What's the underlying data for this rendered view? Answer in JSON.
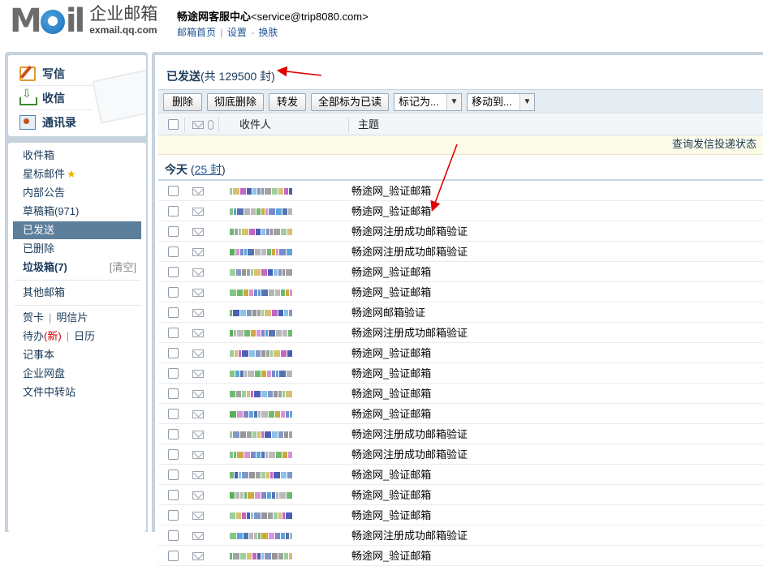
{
  "header": {
    "logo_mark": "M",
    "logo_mark_rest": "il",
    "logo_cn": "企业邮箱",
    "logo_en": "exmail.qq.com",
    "account_name": "畅途网客服中心",
    "account_email": "<service@trip8080.com>",
    "links": [
      "邮箱首页",
      "设置",
      "换肤"
    ],
    "link_sep": "|",
    "link_sep2": "-"
  },
  "quick_actions": [
    {
      "label": "写信",
      "icon": "pencil-icon"
    },
    {
      "label": "收信",
      "icon": "inbox-download-icon"
    },
    {
      "label": "通讯录",
      "icon": "address-book-icon"
    }
  ],
  "folders": {
    "inbox": "收件箱",
    "starred": "星标邮件",
    "notices": "内部公告",
    "drafts": "草稿箱(971)",
    "sent": "已发送",
    "deleted": "已删除",
    "junk": "垃圾箱(7)",
    "junk_clear": "[清空]",
    "other": "其他邮箱",
    "card": "贺卡",
    "postcard": "明信片",
    "todo": "待办",
    "todo_new": "(新)",
    "calendar": "日历",
    "notes": "记事本",
    "disk": "企业网盘",
    "transfer": "文件中转站",
    "pipe": "|"
  },
  "main": {
    "title_bold": "已发送",
    "title_count": "(共 129500 封)",
    "toolbar": {
      "delete": "删除",
      "perm_delete": "彻底删除",
      "forward": "转发",
      "mark_all_read": "全部标为已读",
      "mark_as": "标记为...",
      "move_to": "移动到..."
    },
    "columns": {
      "recipient": "收件人",
      "subject": "主题"
    },
    "notice": "查询发信投递状态",
    "group_label": "今天",
    "group_count_prefix": "(",
    "group_count": "25 封",
    "group_count_suffix": ")",
    "rows": [
      {
        "subject": "畅途网_验证邮箱"
      },
      {
        "subject": "畅途网_验证邮箱"
      },
      {
        "subject": "畅途网注册成功邮箱验证"
      },
      {
        "subject": "畅途网注册成功邮箱验证"
      },
      {
        "subject": "畅途网_验证邮箱"
      },
      {
        "subject": "畅途网_验证邮箱"
      },
      {
        "subject": "畅途网邮箱验证"
      },
      {
        "subject": "畅途网注册成功邮箱验证"
      },
      {
        "subject": "畅途网_验证邮箱"
      },
      {
        "subject": "畅途网_验证邮箱"
      },
      {
        "subject": "畅途网_验证邮箱"
      },
      {
        "subject": "畅途网_验证邮箱"
      },
      {
        "subject": "畅途网注册成功邮箱验证"
      },
      {
        "subject": "畅途网注册成功邮箱验证"
      },
      {
        "subject": "畅途网_验证邮箱"
      },
      {
        "subject": "畅途网_验证邮箱"
      },
      {
        "subject": "畅途网_验证邮箱"
      },
      {
        "subject": "畅途网注册成功邮箱验证"
      },
      {
        "subject": "畅途网_验证邮箱"
      }
    ]
  },
  "colors": {
    "annotation_arrow": "#e00000",
    "panel_bg": "#c6d3de",
    "active_folder": "#5b7e9b"
  }
}
